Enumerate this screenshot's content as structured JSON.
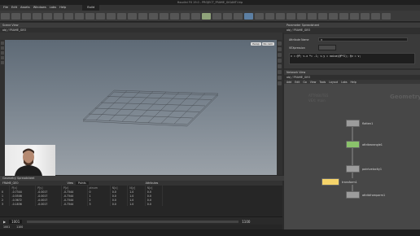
{
  "window": {
    "title": "Houdini FX 19.0 - PROJECT_FRAME_GIGANTI.hip"
  },
  "menu": [
    "File",
    "Edit",
    "Assets",
    "Windows",
    "Labs",
    "Help"
  ],
  "desktop": "Build",
  "viewport": {
    "tab": "Scene View",
    "path": "obj",
    "node": "FRAME_GEO",
    "camera": "Persp",
    "cam_mode": "No cam"
  },
  "param": {
    "tab": "Parameter Spreadsheet",
    "path": "obj",
    "node": "FRAME_GEO",
    "field_label": "Attribute Name",
    "field_value": "v",
    "expr_label": "VEXpression",
    "expr": "v = @P; v.x *= -1; v.y = noise(@P*2); @v = v;"
  },
  "network": {
    "tab": "Network View",
    "path": "obj",
    "node": "FRAME_GEO",
    "menu": [
      "Add",
      "Edit",
      "Go",
      "View",
      "Tools",
      "Layout",
      "Labs",
      "Help"
    ],
    "context_big": "Geometry",
    "context_small_1": "ATTRIBUTES",
    "context_small_2": "VEX: main",
    "nodes": [
      "flatten1",
      "attribwrangle1",
      "pointvelocity1",
      "transform1",
      "attribfromparm1"
    ]
  },
  "spreadsheet": {
    "tab": "Geometry Spreadsheet",
    "node": "FRAME_GEO",
    "filter_label": "View",
    "filter_value": "Points",
    "attr_label": "Attributes",
    "columns": [
      "",
      "P[x]",
      "P[y]",
      "P[z]",
      "ptnum",
      "N[x]",
      "N[y]",
      "N[z]"
    ],
    "rows": [
      [
        "0",
        "-0.7344",
        "-0.0017",
        "-0.7344",
        "0",
        "0.0",
        "1.0",
        "0.0"
      ],
      [
        "1",
        "-0.5508",
        "-0.0017",
        "-0.7344",
        "1",
        "0.0",
        "1.0",
        "0.0"
      ],
      [
        "2",
        "-0.3672",
        "-0.0017",
        "-0.7344",
        "2",
        "0.0",
        "1.0",
        "0.0"
      ],
      [
        "3",
        "-0.1836",
        "-0.0017",
        "-0.7344",
        "3",
        "0.0",
        "1.0",
        "0.0"
      ]
    ]
  },
  "timeline": {
    "start": "1001",
    "end": "1100",
    "current": "1001"
  },
  "colors": {
    "accent": "#8fa37a",
    "selected": "#f5d36a",
    "node_green": "#8ac26b"
  }
}
